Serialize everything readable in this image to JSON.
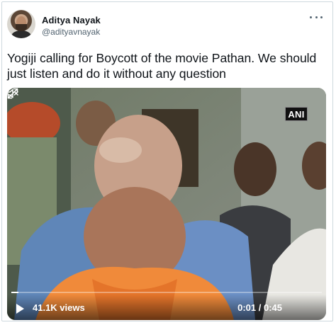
{
  "author": {
    "name": "Aditya Nayak",
    "handle": "@adityavnayak"
  },
  "tweet": {
    "text": "Yogiji calling for Boycott of the movie Pathan. We should just listen and do it without any question"
  },
  "video": {
    "watermark": "ANI",
    "views": "41.1K views",
    "time": "0:01 / 0:45",
    "progress_fraction": 0.022
  },
  "icons": {
    "more": "more-icon",
    "play": "play-icon",
    "volume": "volume-muted-icon",
    "expand": "expand-icon"
  }
}
